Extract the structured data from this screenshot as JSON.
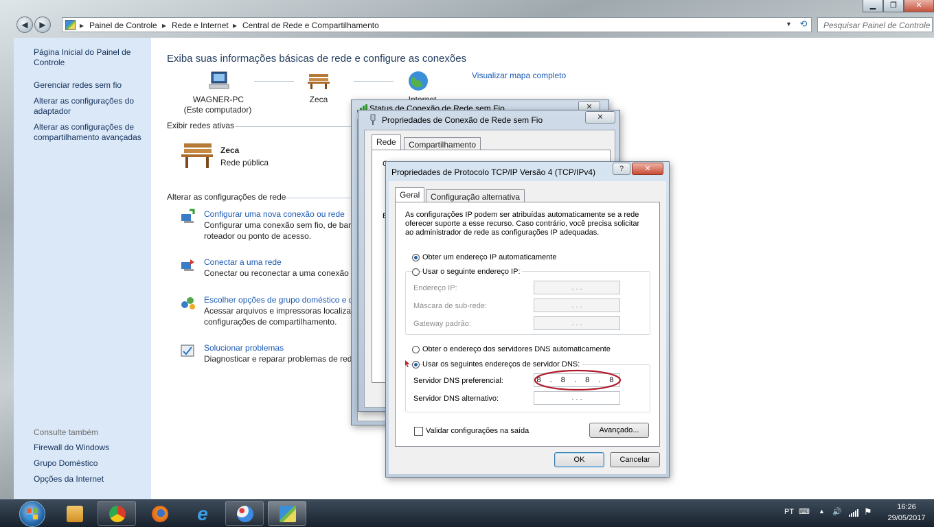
{
  "window_controls": {
    "minimize": "▁",
    "maximize": "❐",
    "close": "✕"
  },
  "address_bar": {
    "crumbs": [
      "Painel de Controle",
      "Rede e Internet",
      "Central de Rede e Compartilhamento"
    ],
    "search_placeholder": "Pesquisar Painel de Controle"
  },
  "left_pane": {
    "links": [
      "Página Inicial do Painel de Controle",
      "Gerenciar redes sem fio",
      "Alterar as configurações do adaptador",
      "Alterar as configurações de compartilhamento avançadas"
    ],
    "see_also": "Consulte também",
    "see_also_links": [
      "Firewall do Windows",
      "Grupo Doméstico",
      "Opções da Internet"
    ]
  },
  "main": {
    "title": "Exiba suas informações básicas de rede e configure as conexões",
    "map": {
      "computer_name": "WAGNER-PC",
      "computer_sub": "(Este computador)",
      "network": "Zeca",
      "internet": "Internet",
      "view_full_map": "Visualizar mapa completo"
    },
    "active_networks_header": "Exibir redes ativas",
    "active_network": {
      "name": "Zeca",
      "type": "Rede pública"
    },
    "change_settings_header": "Alterar as configurações de rede",
    "tasks": [
      {
        "title": "Configurar uma nova conexão ou rede",
        "desc1": "Configurar uma conexão sem fio, de ban",
        "desc2": "roteador ou ponto de acesso."
      },
      {
        "title": "Conectar a uma rede",
        "desc1": "Conectar ou reconectar a uma conexão d",
        "desc2": ""
      },
      {
        "title": "Escolher opções de grupo doméstico e d",
        "desc1": "Acessar arquivos e impressoras localizad",
        "desc2": "configurações de compartilhamento."
      },
      {
        "title": "Solucionar problemas",
        "desc1": "Diagnosticar e reparar problemas de rede",
        "desc2": ""
      }
    ]
  },
  "status_dialog": {
    "title": "Status de Conexão de Rede sem Fio",
    "close": "✕"
  },
  "props_dialog": {
    "title": "Propriedades de Conexão de Rede sem Fio",
    "close": "✕",
    "tabs": [
      "Rede",
      "Compartilhamento"
    ],
    "partial_text1": "C",
    "partial_text2": "E"
  },
  "tcp_dialog": {
    "title": "Propriedades de Protocolo TCP/IP Versão 4 (TCP/IPv4)",
    "help": "?",
    "close": "✕",
    "tabs": [
      "Geral",
      "Configuração alternativa"
    ],
    "description1": "As configurações IP podem ser atribuídas automaticamente se a rede",
    "description2": "oferecer suporte a esse recurso. Caso contrário, você precisa solicitar",
    "description3": "ao administrador de rede as configurações IP adequadas.",
    "ip_auto": "Obter um endereço IP automaticamente",
    "ip_manual": "Usar o seguinte endereço IP:",
    "ip_address_label": "Endereço IP:",
    "subnet_label": "Máscara de sub-rede:",
    "gateway_label": "Gateway padrão:",
    "empty_ip": ".       .       .",
    "dns_auto": "Obter o endereço dos servidores DNS automaticamente",
    "dns_manual": "Usar os seguintes endereços de servidor DNS:",
    "dns_pref_label": "Servidor DNS preferencial:",
    "dns_pref_value": "8 . 8 . 8 . 8",
    "dns_alt_label": "Servidor DNS alternativo:",
    "validate": "Validar configurações na saída",
    "advanced": "Avançado...",
    "ok": "OK",
    "cancel": "Cancelar"
  },
  "taskbar": {
    "lang": "PT",
    "time": "16:26",
    "date": "29/05/2017"
  },
  "colors": {
    "link": "#1c5ab3",
    "left_pane": "#dbe8f7",
    "highlight_ellipse": "#b0192a"
  }
}
